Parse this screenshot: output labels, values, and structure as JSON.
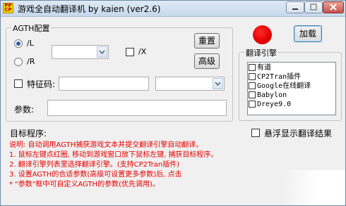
{
  "window": {
    "title": "游戏全自动翻译机  by kaien (ver2.6)",
    "icon_text": "PP CP"
  },
  "agth_group": {
    "label": "AGTH配置",
    "radio_l": "/L",
    "radio_r": "/R",
    "check_x": "/X",
    "check_code_label": "特征码:",
    "param_label": "参数:",
    "reset_button": "重置",
    "advanced_button": "高级"
  },
  "load_button": "加载",
  "engine_group": {
    "label": "翻译引擎",
    "items": [
      "有道",
      "CP2Tran插件",
      "Google在线翻译",
      "Babylon",
      "Dreye9.0"
    ]
  },
  "target_label": "目标程序:",
  "float_checkbox_label": "悬浮显示翻译结果",
  "instructions": [
    "说明: 自动调用AGTH捕获游戏文本并提交翻译引擎自动翻译。",
    "1. 鼠标左键点红圈, 移动到游戏窗口放下鼠标左键, 捕获目标程序。",
    "2. 翻译引擎列表里选择翻译引擎。(支持CP2Tran插件)",
    "3. 设置AGTH的合适参数(高级可设置更多参数)后, 点击",
    "* \"参数\"框中可自定义AGTH的参数(优先调用)。"
  ],
  "colors": {
    "indicator": "#e20000",
    "instruction_text": "#e60000"
  }
}
